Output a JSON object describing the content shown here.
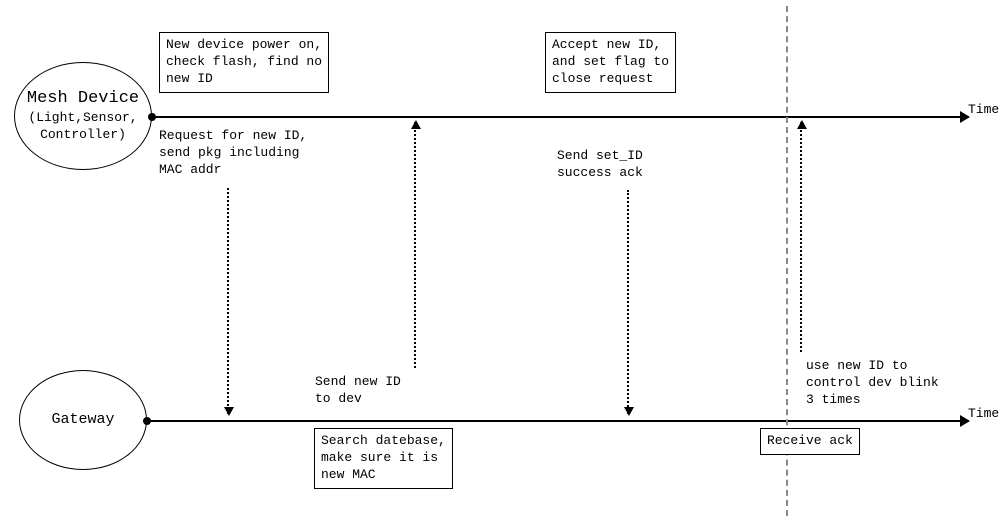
{
  "actors": {
    "mesh": {
      "title": "Mesh Device",
      "subtitle": "(Light,Sensor,\nController)"
    },
    "gateway": {
      "title": "Gateway"
    }
  },
  "time_label": "Time",
  "boxes": {
    "poweron": "New device power on,\ncheck flash, find no\nnew ID",
    "accept": "Accept new ID,\nand set flag to\nclose request",
    "search": "Search datebase,\nmake sure it is\nnew MAC",
    "receive_ack": "Receive ack"
  },
  "labels": {
    "request": "Request for new ID,\nsend pkg including\nMAC addr",
    "send_new_id": "Send new ID\nto dev",
    "send_ack": "Send set_ID\nsuccess ack",
    "use_new_id": "use new ID to\ncontrol dev blink\n3 times"
  }
}
